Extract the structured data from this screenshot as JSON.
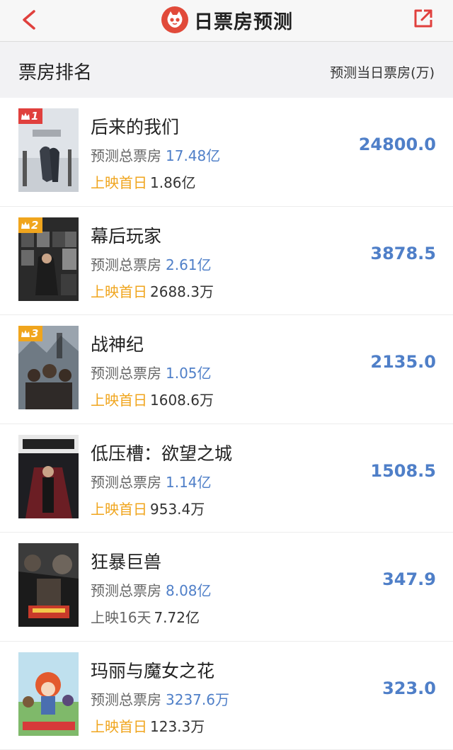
{
  "nav": {
    "title": "日票房预测",
    "back_icon": "chevron-left-icon",
    "share_icon": "share-icon",
    "accent": "#e0403d"
  },
  "header": {
    "left": "票房排名",
    "right": "预测当日票房(万)"
  },
  "movies": [
    {
      "rank": "1",
      "name": "后来的我们",
      "total_label": "预测总票房",
      "total": "17.48亿",
      "second_label": "上映首日",
      "second_value": "1.86亿",
      "daily": "24800.0"
    },
    {
      "rank": "2",
      "name": "幕后玩家",
      "total_label": "预测总票房",
      "total": "2.61亿",
      "second_label": "上映首日",
      "second_value": "2688.3万",
      "daily": "3878.5"
    },
    {
      "rank": "3",
      "name": "战神纪",
      "total_label": "预测总票房",
      "total": "1.05亿",
      "second_label": "上映首日",
      "second_value": "1608.6万",
      "daily": "2135.0"
    },
    {
      "rank": "",
      "name": "低压槽：欲望之城",
      "total_label": "预测总票房",
      "total": "1.14亿",
      "second_label": "上映首日",
      "second_value": "953.4万",
      "daily": "1508.5"
    },
    {
      "rank": "",
      "name": "狂暴巨兽",
      "total_label": "预测总票房",
      "total": "8.08亿",
      "second_label": "上映16天",
      "second_value": "7.72亿",
      "daily": "347.9"
    },
    {
      "rank": "",
      "name": "玛丽与魔女之花",
      "total_label": "预测总票房",
      "total": "3237.6万",
      "second_label": "上映首日",
      "second_value": "123.3万",
      "daily": "323.0"
    }
  ]
}
